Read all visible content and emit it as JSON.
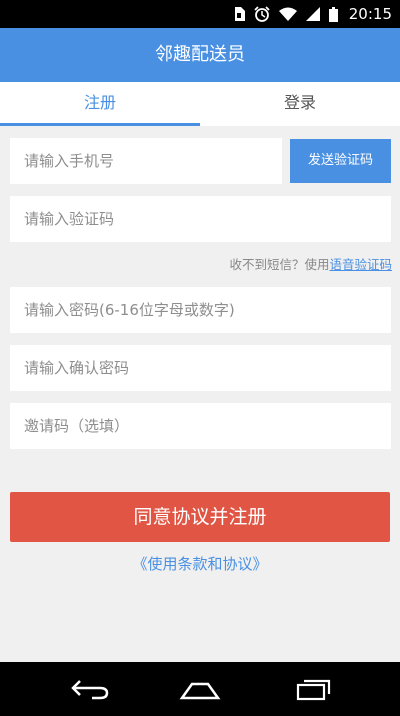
{
  "status_bar": {
    "time": "20:15",
    "icons": [
      "sim-card-icon",
      "alarm-icon",
      "wifi-icon",
      "signal-icon",
      "battery-icon"
    ]
  },
  "app_bar": {
    "title": "邻趣配送员"
  },
  "tabs": [
    {
      "label": "注册",
      "active": true
    },
    {
      "label": "登录",
      "active": false
    }
  ],
  "form": {
    "phone_placeholder": "请输入手机号",
    "send_code_label": "发送验证码",
    "code_placeholder": "请输入验证码",
    "hint_text": "收不到短信？使用",
    "voice_code_link": "语音验证码",
    "password_placeholder": "请输入密码(6-16位字母或数字)",
    "confirm_password_placeholder": "请输入确认密码",
    "invite_placeholder": "邀请码（选填）"
  },
  "register_button": "同意协议并注册",
  "terms_link": "《使用条款和协议》",
  "colors": {
    "accent": "#4a90e2",
    "register": "#e05543"
  },
  "nav_bar": {
    "icons": [
      "back-icon",
      "home-icon",
      "recent-apps-icon"
    ]
  }
}
